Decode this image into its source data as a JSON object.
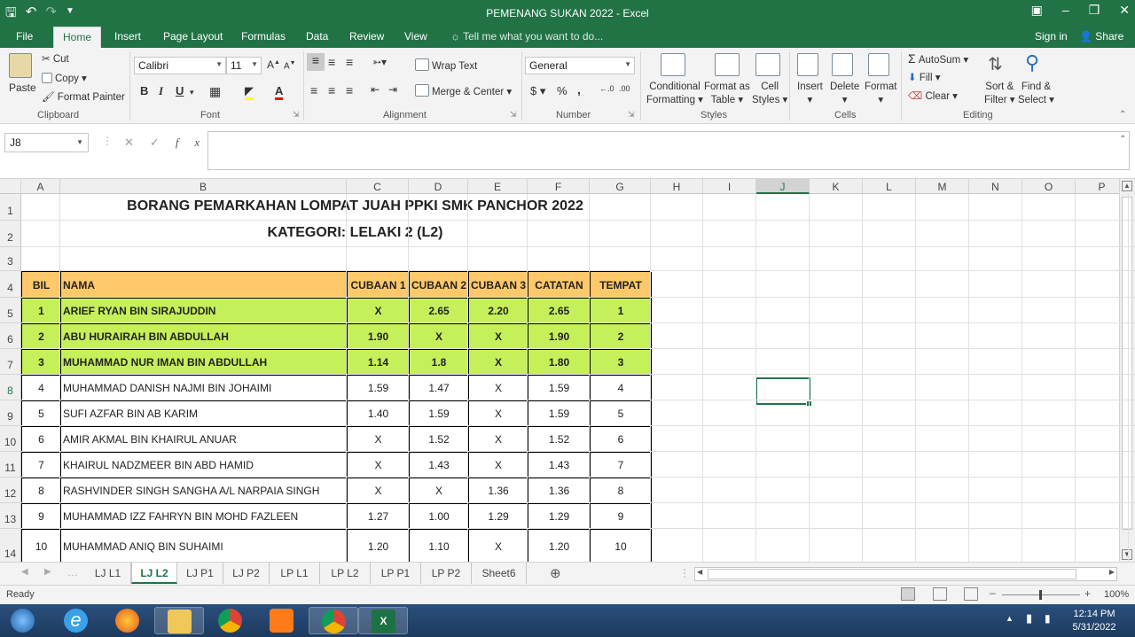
{
  "window": {
    "title": "PEMENANG SUKAN 2022 - Excel",
    "qat_icons": [
      "save-icon",
      "undo-icon",
      "redo-icon",
      "customize-icon"
    ]
  },
  "ribbon_tabs": [
    "File",
    "Home",
    "Insert",
    "Page Layout",
    "Formulas",
    "Data",
    "Review",
    "View"
  ],
  "active_tab": "Home",
  "tell_me": "Tell me what you want to do...",
  "sign_in": "Sign in",
  "share": "Share",
  "clipboard": {
    "paste": "Paste",
    "cut": "Cut",
    "copy": "Copy",
    "format_painter": "Format Painter",
    "label": "Clipboard"
  },
  "font": {
    "name": "Calibri",
    "size": "11",
    "label": "Font"
  },
  "alignment": {
    "wrap": "Wrap Text",
    "merge": "Merge & Center",
    "label": "Alignment"
  },
  "number": {
    "format": "General",
    "label": "Number"
  },
  "styles": {
    "conditional": [
      "Conditional",
      "Formatting"
    ],
    "format_table": [
      "Format as",
      "Table"
    ],
    "cell_styles": [
      "Cell",
      "Styles"
    ],
    "label": "Styles"
  },
  "cells": {
    "insert": "Insert",
    "delete": "Delete",
    "format": "Format",
    "label": "Cells"
  },
  "editing": {
    "autosum": "AutoSum",
    "fill": "Fill",
    "clear": "Clear",
    "sort": [
      "Sort &",
      "Filter"
    ],
    "find": [
      "Find &",
      "Select"
    ],
    "label": "Editing"
  },
  "name_box": "J8",
  "columns": [
    "A",
    "B",
    "C",
    "D",
    "E",
    "F",
    "G",
    "H",
    "I",
    "J",
    "K",
    "L",
    "M",
    "N",
    "O",
    "P"
  ],
  "rows": [
    "1",
    "2",
    "3",
    "4",
    "5",
    "6",
    "7",
    "8",
    "9",
    "10",
    "11",
    "12",
    "13",
    "14"
  ],
  "sheet": {
    "title": "BORANG PEMARKAHAN LOMPAT JUAH PPKI SMK PANCHOR 2022",
    "subtitle": "KATEGORI: LELAKI 2 (L2)",
    "headers": [
      "BIL",
      "NAMA",
      "CUBAAN 1",
      "CUBAAN 2",
      "CUBAAN 3",
      "CATATAN",
      "TEMPAT"
    ],
    "rows": [
      [
        "1",
        "ARIEF RYAN BIN SIRAJUDDIN",
        "X",
        "2.65",
        "2.20",
        "2.65",
        "1"
      ],
      [
        "2",
        "ABU HURAIRAH BIN ABDULLAH",
        "1.90",
        "X",
        "X",
        "1.90",
        "2"
      ],
      [
        "3",
        "MUHAMMAD NUR IMAN BIN ABDULLAH",
        "1.14",
        "1.8",
        "X",
        "1.80",
        "3"
      ],
      [
        "4",
        "MUHAMMAD DANISH NAJMI BIN JOHAIMI",
        "1.59",
        "1.47",
        "X",
        "1.59",
        "4"
      ],
      [
        "5",
        "SUFI AZFAR BIN AB KARIM",
        "1.40",
        "1.59",
        "X",
        "1.59",
        "5"
      ],
      [
        "6",
        "AMIR AKMAL BIN KHAIRUL ANUAR",
        "X",
        "1.52",
        "X",
        "1.52",
        "6"
      ],
      [
        "7",
        "KHAIRUL NADZMEER BIN ABD HAMID",
        "X",
        "1.43",
        "X",
        "1.43",
        "7"
      ],
      [
        "8",
        "RASHVINDER SINGH SANGHA A/L NARPAIA SINGH",
        "X",
        "X",
        "1.36",
        "1.36",
        "8"
      ],
      [
        "9",
        "MUHAMMAD IZZ FAHRYN BIN MOHD FAZLEEN",
        "1.27",
        "1.00",
        "1.29",
        "1.29",
        "9"
      ],
      [
        "10",
        "MUHAMMAD ANIQ BIN SUHAIMI",
        "1.20",
        "1.10",
        "X",
        "1.20",
        "10"
      ]
    ],
    "highlight_color": "#c6f05a",
    "header_color": "#ffc86b"
  },
  "sheet_tabs": [
    "LJ L1",
    "LJ L2",
    "LJ P1",
    "LJ P2",
    "LP L1",
    "LP L2",
    "LP P1",
    "LP P2",
    "Sheet6"
  ],
  "active_sheet": "LJ L2",
  "status": {
    "ready": "Ready",
    "zoom": "100%"
  },
  "clock": {
    "time": "12:14 PM",
    "date": "5/31/2022"
  },
  "taskbar_apps": [
    "start-icon",
    "internet-explorer-icon",
    "firefox-icon",
    "file-explorer-icon",
    "chrome-icon",
    "media-player-icon",
    "chrome-profile-icon",
    "excel-icon"
  ],
  "colors": {
    "excel_green": "#217346"
  }
}
